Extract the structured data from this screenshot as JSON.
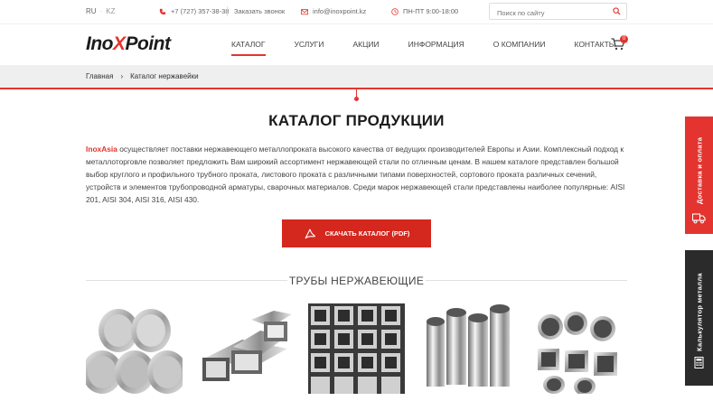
{
  "topbar": {
    "lang_active": "RU",
    "lang_other": "KZ",
    "phone": "+7 (727) 357-38-38",
    "callback": "Заказать звонок",
    "email": "info@inoxpoint.kz",
    "hours": "ПН-ПТ  9:00-18:00",
    "search_placeholder": "Поиск по сайту"
  },
  "header": {
    "logo_a": "Ino",
    "logo_x": "X",
    "logo_b": "Point",
    "nav": [
      "КАТАЛОГ",
      "УСЛУГИ",
      "АКЦИИ",
      "ИНФОРМАЦИЯ",
      "О КОМПАНИИ",
      "КОНТАКТЫ"
    ],
    "cart_count": "0"
  },
  "breadcrumb": {
    "home": "Главная",
    "sep": "›",
    "current": "Каталог нержавейки"
  },
  "main": {
    "title": "КАТАЛОГ ПРОДУКЦИИ",
    "brand": "InoxAsia",
    "intro": " осуществляет поставки нержавеющего металлопроката высокого качества от ведущих производителей Европы и Азии. Комплексный подход к металлоторговле позволяет предложить Вам широкий ассортимент нержавеющей стали по отличным ценам. В нашем каталоге представлен большой выбор круглого и профильного трубного проката, листового проката с различными типами поверхностей, сортового проката различных сечений, устройств и элементов трубопроводной арматуры, сварочных материалов. Среди марок нержавеющей стали представлены наиболее популярные: AISI 201, AISI 304, AISI 316, AISI 430.",
    "download_label": "СКАЧАТЬ КАТАЛОГ (PDF)",
    "section_title": "ТРУБЫ НЕРЖАВЕЮЩИЕ"
  },
  "side": {
    "delivery": "Доставка и оплата",
    "calculator": "Калькулятор металла"
  },
  "colors": {
    "accent": "#e3342f",
    "button": "#d4271d",
    "dark_tab": "#2b2b2b"
  }
}
